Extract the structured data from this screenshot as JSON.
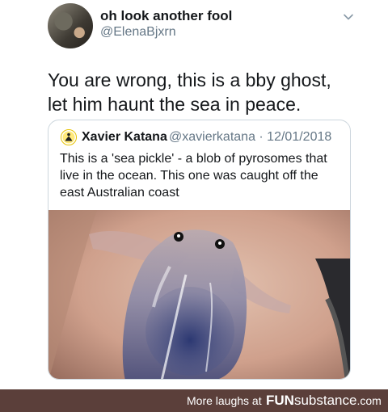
{
  "tweet": {
    "display_name": "oh look another fool",
    "handle": "@ElenaBjxrn",
    "text": "You are wrong, this is a bby ghost, let him haunt the sea in peace."
  },
  "quoted_tweet": {
    "display_name": "Xavier Katana",
    "handle_and_date": "@xavierkatana · 12/01/2018",
    "text": "This is a 'sea pickle' - a blob of pyrosomes that live in the ocean. This one was caught off the east Australian coast",
    "media_description": "hand holding a translucent sea pickle"
  },
  "footer": {
    "more_laughs": "More laughs at",
    "brand_bold": "FUN",
    "brand_rest": "substance",
    "brand_suffix": ".com"
  },
  "icons": {
    "menu": "chevron-down-icon",
    "quote_avatar": "meditating-figure-icon"
  },
  "colors": {
    "text": "#14171a",
    "secondary_text": "#657786",
    "border": "#ccd6dd",
    "footer_bg": "#5b3f3a"
  }
}
